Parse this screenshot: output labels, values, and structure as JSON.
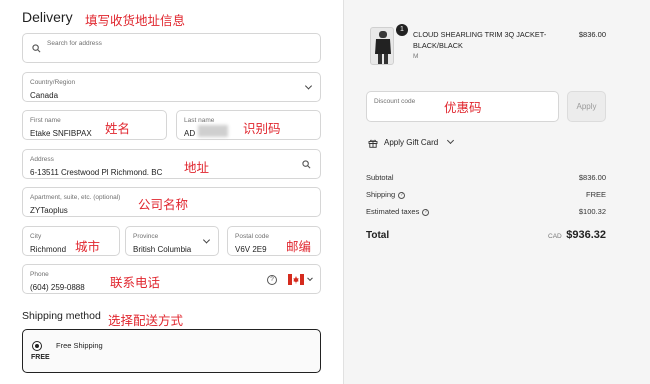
{
  "delivery": {
    "title": "Delivery",
    "annotation_title": "填写收货地址信息",
    "search_placeholder": "Search for address",
    "country_label": "Country/Region",
    "country_value": "Canada",
    "first_name_label": "First name",
    "first_name_value": "Etake SNFIBPAX",
    "last_name_label": "Last name",
    "last_name_value": "AD",
    "annotation_name": "姓名",
    "annotation_id": "识别码",
    "address_label": "Address",
    "address_value": "6-13511 Crestwood Pl Richmond. BC",
    "annotation_address": "地址",
    "apartment_label": "Apartment, suite, etc. (optional)",
    "apartment_value": "ZYTaoplus",
    "annotation_company": "公司名称",
    "city_label": "City",
    "city_value": "Richmond",
    "annotation_city": "城市",
    "province_label": "Province",
    "province_value": "British Columbia",
    "postal_label": "Postal code",
    "postal_value": "V6V 2E9",
    "annotation_postal": "邮编",
    "phone_label": "Phone",
    "phone_value": "(604) 259-0888",
    "annotation_phone": "联系电话",
    "shipping_title": "Shipping method",
    "annotation_shipping": "选择配送方式",
    "shipping_option": "Free Shipping",
    "shipping_price": "FREE"
  },
  "summary": {
    "qty": "1",
    "product_name": "CLOUD SHEARLING TRIM 3Q JACKET- BLACK/BLACK",
    "product_variant": "M",
    "product_price": "$836.00",
    "discount_label": "Discount code",
    "annotation_discount": "优惠码",
    "apply_label": "Apply",
    "gift_label": "Apply Gift Card",
    "subtotal_label": "Subtotal",
    "subtotal_value": "$836.00",
    "shipping_label": "Shipping",
    "shipping_value": "FREE",
    "taxes_label": "Estimated taxes",
    "taxes_value": "$100.32",
    "total_label": "Total",
    "total_currency": "CAD",
    "total_value": "$936.32"
  },
  "icons": [
    "search-icon",
    "chevron-down-icon",
    "help-icon",
    "canada-flag-icon",
    "gift-icon"
  ],
  "colors": {
    "annotation": "#e0262e",
    "panel_bg": "#f5f5f5"
  }
}
